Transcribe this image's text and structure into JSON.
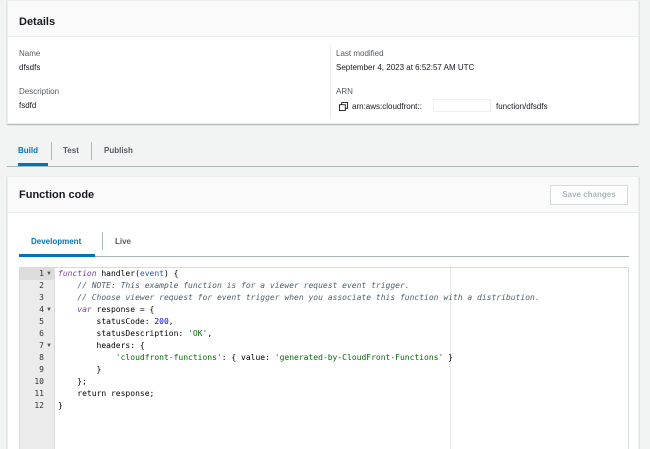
{
  "details": {
    "title": "Details",
    "name_label": "Name",
    "name_value": "dfsdfs",
    "description_label": "Description",
    "description_value": "fsdfd",
    "last_modified_label": "Last modified",
    "last_modified_value": "September 4, 2023 at 6:52:57 AM UTC",
    "arn_label": "ARN",
    "arn_prefix": "arn:aws:cloudfront::",
    "arn_suffix": "function/dfsdfs"
  },
  "tabs": [
    "Build",
    "Test",
    "Publish"
  ],
  "code_panel": {
    "title": "Function code",
    "save_button": "Save changes",
    "subtabs": [
      "Development",
      "Live"
    ]
  },
  "editor": {
    "line_numbers": [
      "1",
      "2",
      "3",
      "4",
      "5",
      "6",
      "7",
      "8",
      "9",
      "10",
      "11",
      "12"
    ],
    "fold_lines": [
      "1",
      "4",
      "7"
    ],
    "lines": {
      "l1": {
        "kw": "function",
        "a": " handler(",
        "param": "event",
        "b": ") {"
      },
      "l2": "    // NOTE: This example function is for a viewer request event trigger.",
      "l3": "    // Choose viewer request for event trigger when you associate this function with a distribution.",
      "l4": {
        "indent": "    ",
        "kw": "var",
        "rest": " response = {"
      },
      "l5": {
        "a": "        statusCode: ",
        "num": "200",
        "b": ","
      },
      "l6": {
        "a": "        statusDescription: ",
        "str": "'OK'",
        "b": ","
      },
      "l7": "        headers: {",
      "l8": {
        "indent": "            ",
        "str1": "'cloudfront-functions'",
        "mid": ": { value: ",
        "str2": "'generated-by-CloudFront-Functions'",
        "end": " }"
      },
      "l9": "        }",
      "l10": "    };",
      "l11": "    return response;",
      "l12": "}"
    }
  },
  "colors": {
    "accent": "#0073bb",
    "keyword": "#7a3e9d",
    "string": "#036a07",
    "comment": "#4d5f6b",
    "number": "#0000cd"
  }
}
